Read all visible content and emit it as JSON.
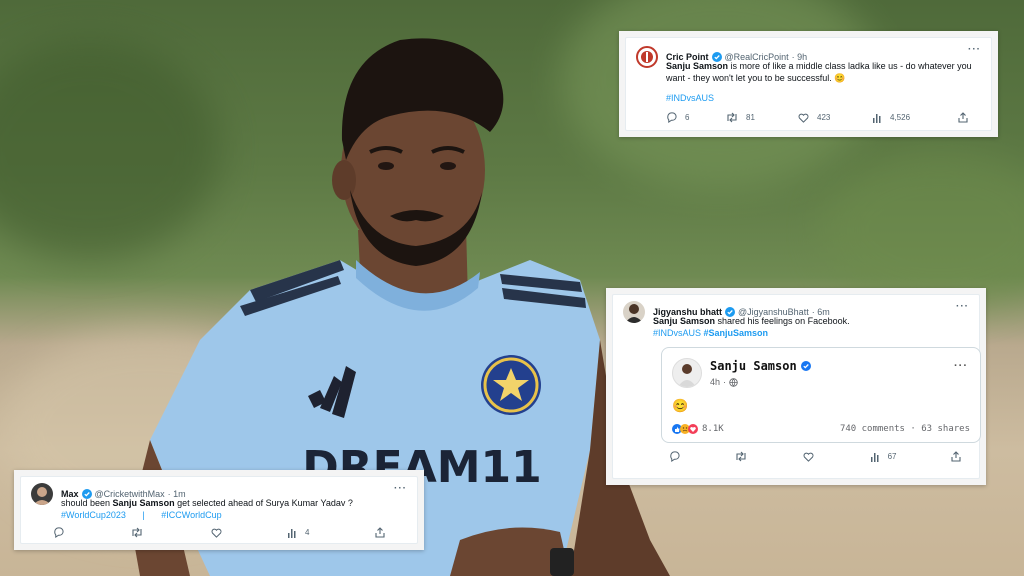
{
  "tweets": {
    "cricpoint": {
      "name": "Cric Point",
      "handle": "@RealCricPoint",
      "time": "· 9h",
      "more": "···",
      "subject": "Sanju Samson",
      "text_rest": " is more of like a middle class ladka like us - do whatever you want - they won't let you to be successful. 😊",
      "hashtag": "#INDvsAUS",
      "replies": "6",
      "retweets": "81",
      "likes": "423",
      "views": "4,526"
    },
    "jigyanshu": {
      "name": "Jigyanshu bhatt",
      "handle": "@JigyanshuBhatt",
      "time": "· 6m",
      "more": "···",
      "subject": "Sanju Samson",
      "text_rest": " shared his feelings on Facebook.",
      "hashtag1": "#INDvsAUS",
      "hashtag2": "#SanjuSamson",
      "views": "67",
      "facebook": {
        "name": "Sanju Samson",
        "time": "4h",
        "more": "···",
        "post": "😊",
        "reactions": "8.1K",
        "comments_shares": "740 comments · 63 shares"
      }
    },
    "max": {
      "name": "Max",
      "handle": "@CricketwithMax",
      "time": "· 1m",
      "more": "···",
      "text_pre": "should been ",
      "subject": "Sanju Samson",
      "text_rest": " get selected ahead of Surya Kumar Yadav ?",
      "hashtag1": "#WorldCup2023",
      "separator": "|",
      "hashtag2": "#ICCWorldCup",
      "views": "4"
    }
  },
  "jersey": {
    "sponsor": "DREAM11"
  },
  "colors": {
    "twitter_blue": "#1d9bf0",
    "jersey": "#9ec7ea",
    "verified": "#1d9bf0"
  }
}
